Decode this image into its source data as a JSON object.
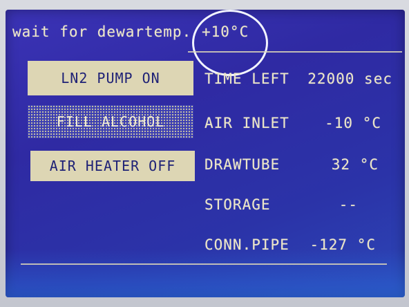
{
  "status": {
    "message": "wait for dewartemp.",
    "temperature": "+10°C"
  },
  "buttons": {
    "ln2_pump": "LN2 PUMP ON",
    "fill_alcohol": "FILL ALCOHOL",
    "air_heater": "AIR HEATER OFF"
  },
  "readings": [
    {
      "label": "TIME LEFT",
      "value": "22000 sec"
    },
    {
      "label": "AIR INLET",
      "value": "-10 °C"
    },
    {
      "label": "DRAWTUBE",
      "value": "32 °C"
    },
    {
      "label": "STORAGE",
      "value": "--"
    },
    {
      "label": "CONN.PIPE",
      "value": "-127 °C"
    }
  ],
  "colors": {
    "screen": "#3233ad",
    "lcd_text": "#ece6c8",
    "button_fill": "#ddd6b4",
    "highlight_circle": "#f2f4ff"
  }
}
